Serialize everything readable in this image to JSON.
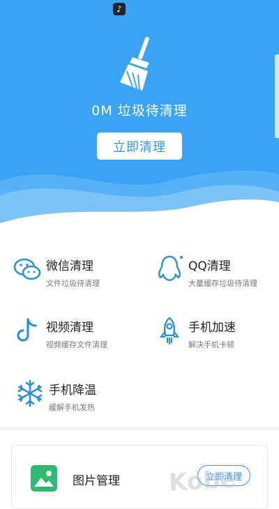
{
  "status_bar": {
    "app_icon": "tiktok-icon"
  },
  "hero": {
    "icon": "broom-icon",
    "junk_text": "0M 垃圾待清理",
    "clean_button": "立即清理",
    "bg_color": "#3aa3f5"
  },
  "features": [
    {
      "title": "微信清理",
      "subtitle": "文件垃圾待清理",
      "icon": "wechat-icon"
    },
    {
      "title": "QQ清理",
      "subtitle": "大量缓存垃圾待清理",
      "icon": "qq-penguin-icon"
    },
    {
      "title": "视频清理",
      "subtitle": "视频缓存文件清理",
      "icon": "tiktok-icon"
    },
    {
      "title": "手机加速",
      "subtitle": "解决手机卡顿",
      "icon": "rocket-icon"
    },
    {
      "title": "手机降温",
      "subtitle": "缓解手机发热",
      "icon": "snowflake-icon"
    }
  ],
  "picture_card": {
    "title": "图片管理",
    "button": "立即清理",
    "icon": "image-icon"
  },
  "watermark": "Kobe",
  "accent": "#2f95ee",
  "icon_color": "#2a8fd9"
}
